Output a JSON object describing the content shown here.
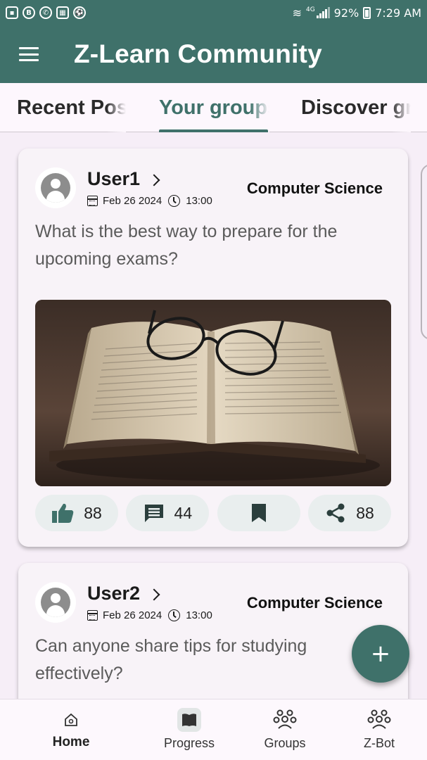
{
  "status_bar": {
    "network": "4G",
    "battery": "92%",
    "time": "7:29 AM"
  },
  "app_bar": {
    "title": "Z-Learn Community"
  },
  "tabs": [
    {
      "label": "Recent Posts",
      "active": false
    },
    {
      "label": "Your groups",
      "active": true
    },
    {
      "label": "Discover groups",
      "active": false
    }
  ],
  "posts": [
    {
      "user": "User1",
      "date": "Feb 26 2024",
      "time": "13:00",
      "group": "Computer Science",
      "question": "What is the best way to prepare for the upcoming exams?",
      "has_image": true,
      "likes": "88",
      "comments": "44",
      "shares": "88"
    },
    {
      "user": "User2",
      "date": "Feb 26 2024",
      "time": "13:00",
      "group": "Computer Science",
      "question": "Can anyone share tips for studying effectively?"
    }
  ],
  "bottom_nav": [
    {
      "label": "Home",
      "active": true
    },
    {
      "label": "Progress",
      "active": false
    },
    {
      "label": "Groups",
      "active": false
    },
    {
      "label": "Z-Bot",
      "active": false
    }
  ],
  "colors": {
    "primary": "#3f716a",
    "background": "#f6eef7",
    "card": "#f8f3f8"
  }
}
